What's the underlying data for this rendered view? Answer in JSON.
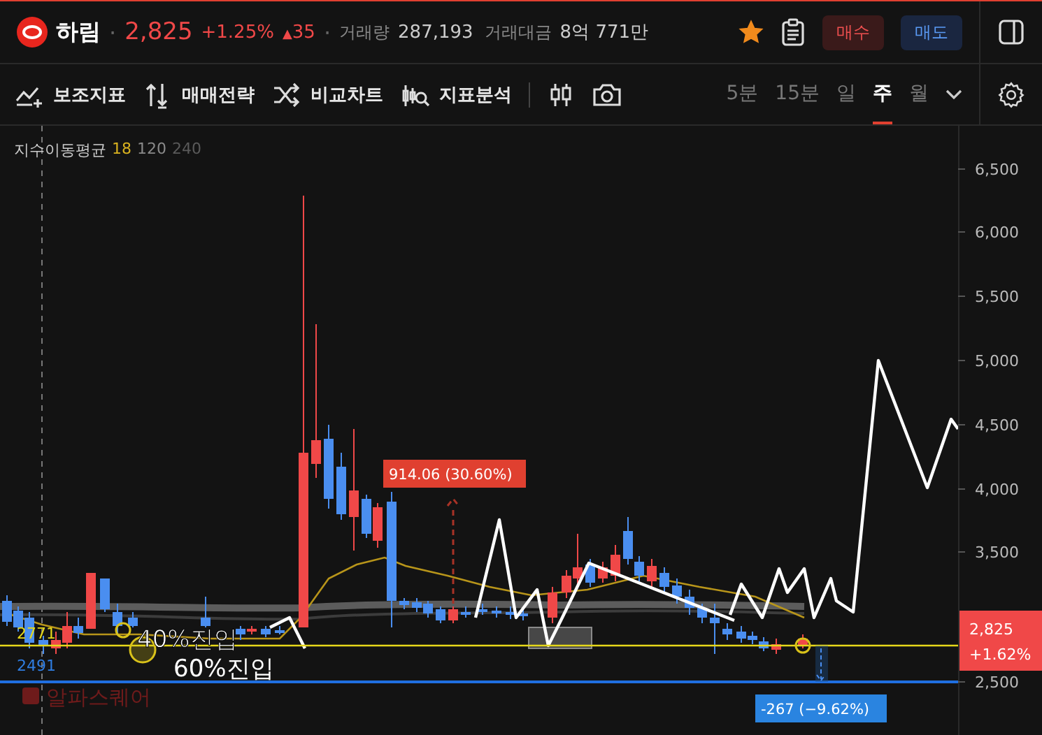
{
  "header": {
    "stock_name": "하림",
    "price": "2,825",
    "change_pct": "+1.25%",
    "change_arrow": "▲",
    "change_abs": "35",
    "volume_label": "거래량",
    "volume": "287,193",
    "amount_label": "거래대금",
    "amount": "8억 771만",
    "favorite": true,
    "separators": [
      "·",
      "·"
    ],
    "buy_button": "매수",
    "sell_button": "매도"
  },
  "toolbar": {
    "tools": [
      {
        "kind": "indicator",
        "label": "보조지표"
      },
      {
        "kind": "strategy",
        "label": "매매전략"
      },
      {
        "kind": "compare",
        "label": "비교차트"
      },
      {
        "kind": "analysis",
        "label": "지표분석"
      }
    ],
    "periods": [
      {
        "label": "5분",
        "selected": false
      },
      {
        "label": "15분",
        "selected": false
      },
      {
        "label": "일",
        "selected": false
      },
      {
        "label": "주",
        "selected": true
      },
      {
        "label": "월",
        "selected": false
      }
    ]
  },
  "chart": {
    "legend": {
      "title": "지수이동평균",
      "periods": [
        {
          "label": "18",
          "color": "#d9b21f"
        },
        {
          "label": "120",
          "color": "#8a8a8a"
        },
        {
          "label": "240",
          "color": "#5a5a5a"
        }
      ]
    },
    "y_ticks": [
      "6,500",
      "6,000",
      "5,500",
      "5,000",
      "4,500",
      "4,000",
      "3,500",
      "2,500"
    ],
    "price_tag": {
      "price": "2,825",
      "change": "+1.62%"
    },
    "level_labels": [
      {
        "text": "2771",
        "color": "#e6d81a"
      },
      {
        "text": "2491",
        "color": "#2f7de1"
      }
    ],
    "annotations": [
      "40%진입",
      "60%진입"
    ],
    "measure_up": "914.06 (30.60%)",
    "measure_down": "-267 (−9.62%)",
    "watermark": "알파스퀘어"
  }
}
